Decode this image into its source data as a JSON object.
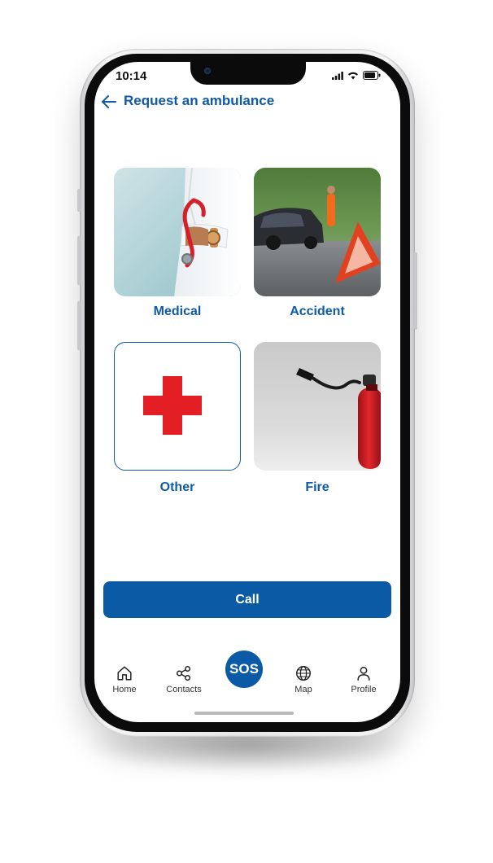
{
  "status_bar": {
    "time": "10:14"
  },
  "header": {
    "title": "Request an ambulance"
  },
  "categories": [
    {
      "label": "Medical",
      "image": "doctor-with-stethoscope"
    },
    {
      "label": "Accident",
      "image": "car-crash-warning-triangle"
    },
    {
      "label": "Other",
      "icon": "red-cross-icon"
    },
    {
      "label": "Fire",
      "image": "fire-extinguisher"
    }
  ],
  "call_button": {
    "label": "Call"
  },
  "bottom_nav": {
    "home": "Home",
    "contacts": "Contacts",
    "sos": "SOS",
    "map": "Map",
    "profile": "Profile"
  },
  "colors": {
    "primary": "#0a5aa5",
    "title": "#1059a6",
    "cross_red": "#e31e24"
  }
}
